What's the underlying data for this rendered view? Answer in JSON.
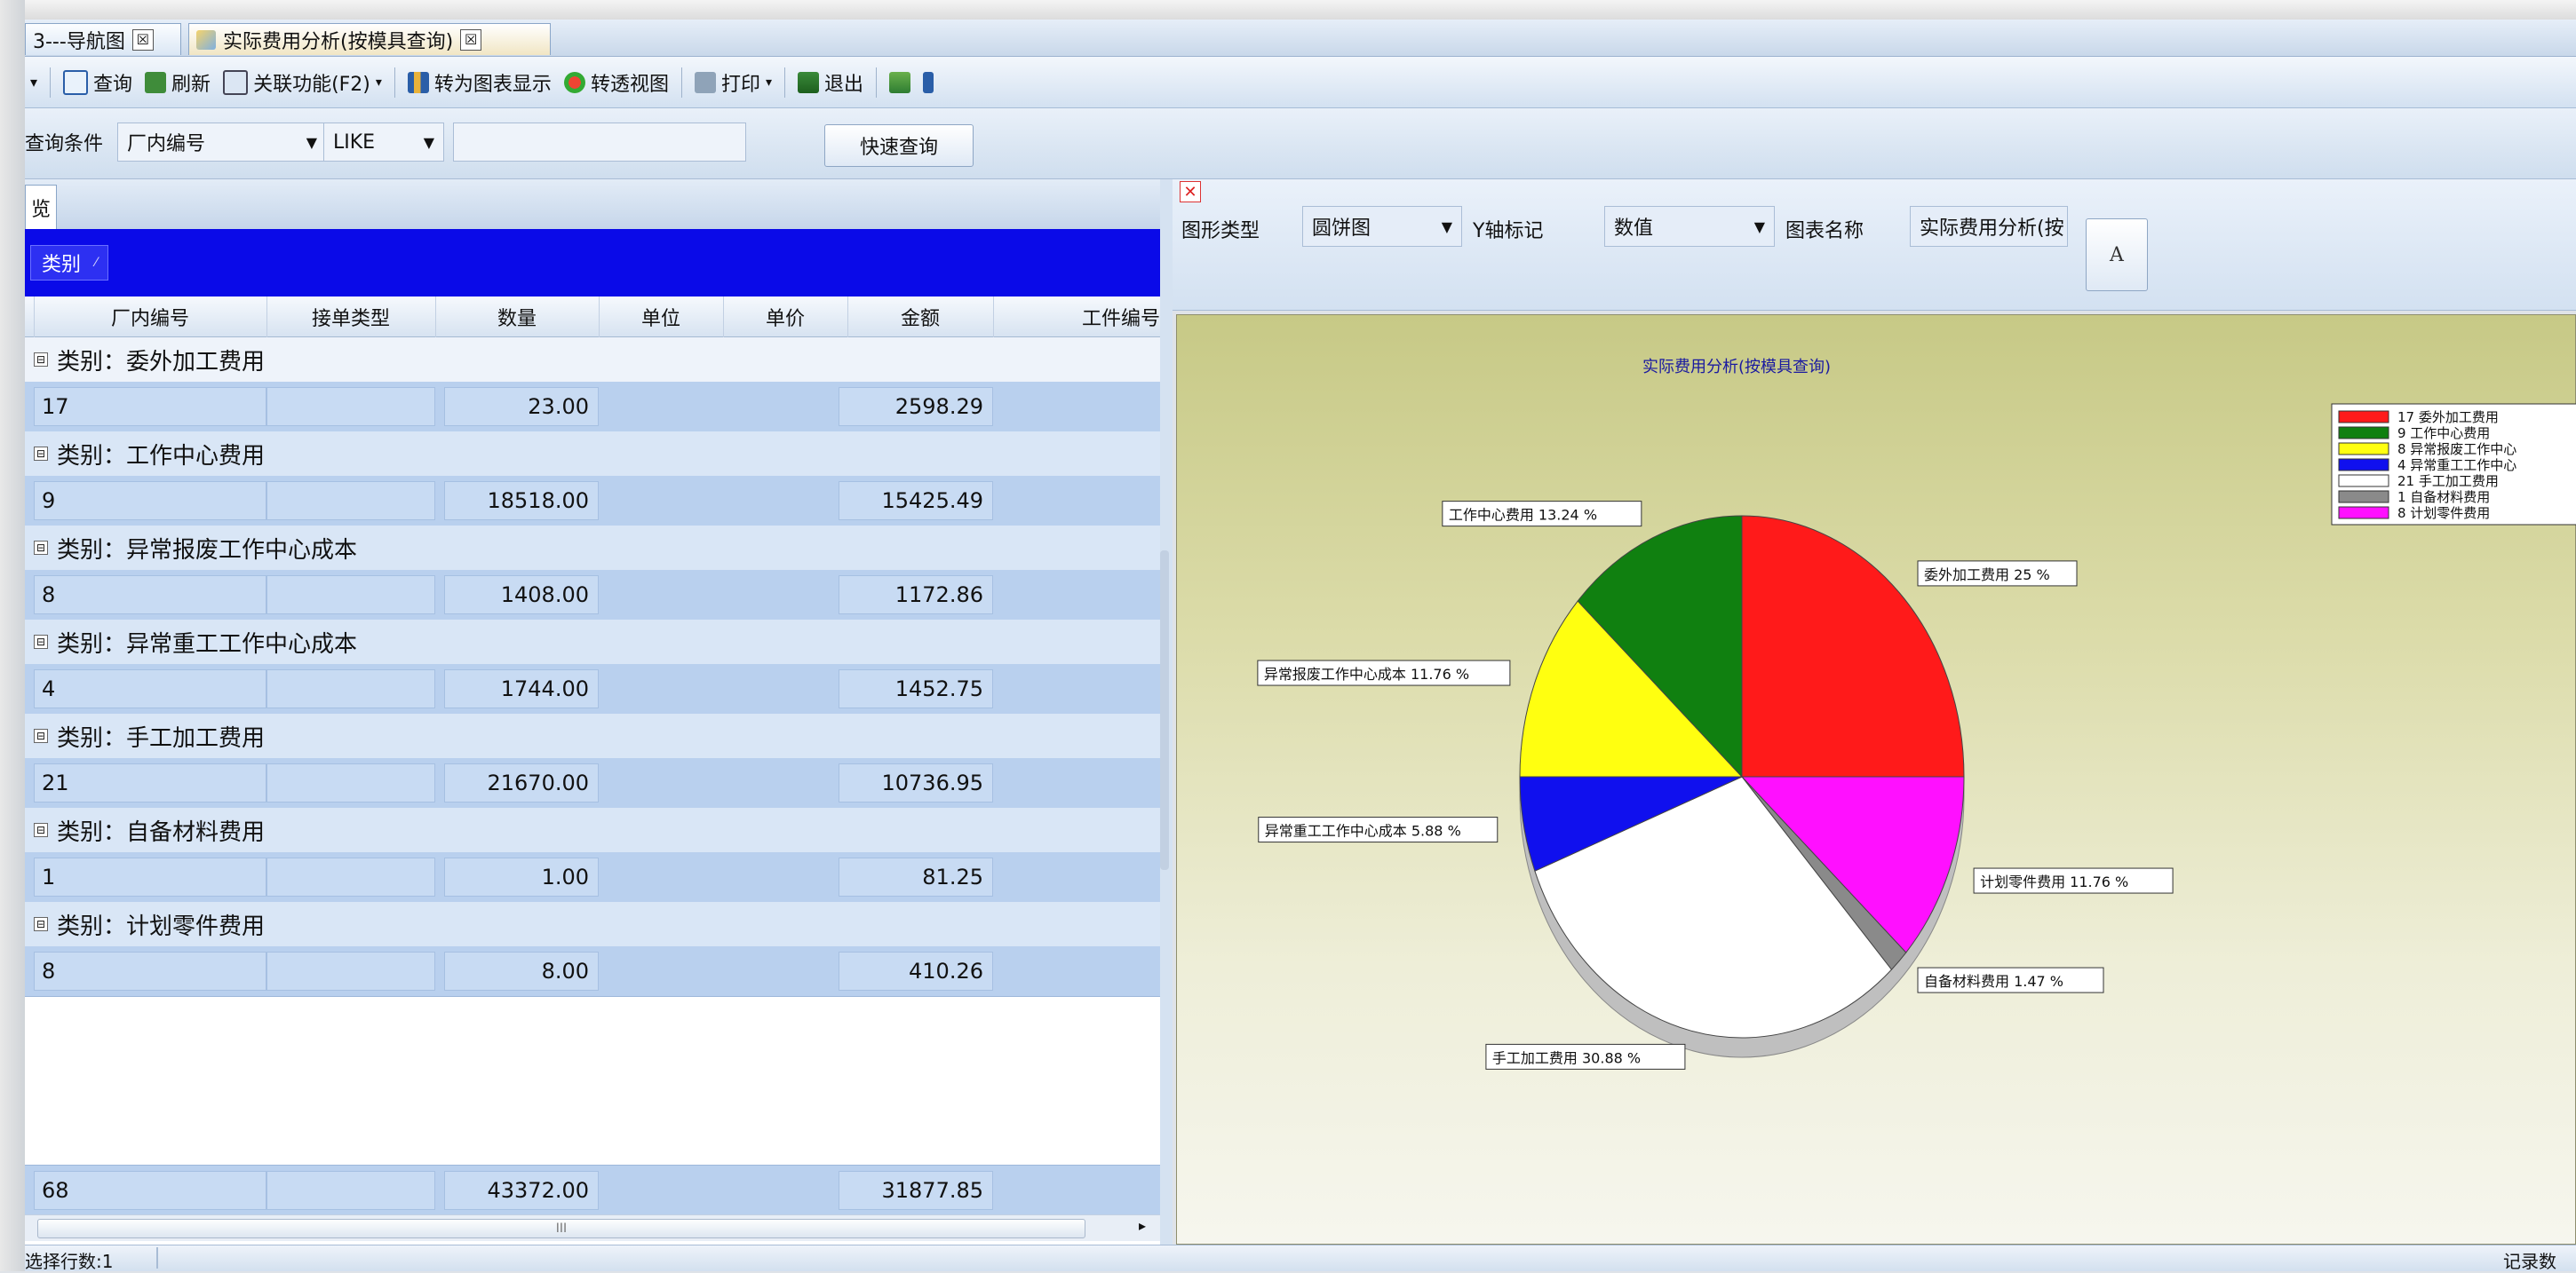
{
  "tabs": [
    {
      "label": "3---导航图",
      "close": "☒"
    },
    {
      "label": "实际费用分析(按模具查询)",
      "close": "☒"
    }
  ],
  "toolbar": {
    "query": "查询",
    "refresh": "刷新",
    "related": "关联功能(F2)",
    "to_chart": "转为图表显示",
    "pivot": "转透视图",
    "print": "打印",
    "exit": "退出"
  },
  "querybar": {
    "label": "查询条件",
    "field": "厂内编号",
    "operator": "LIKE",
    "value": "",
    "quick_query": "快速查询"
  },
  "left_panel": {
    "tab_label": "览",
    "group_chip": "类别",
    "columns": [
      "厂内编号",
      "接单类型",
      "数量",
      "单位",
      "单价",
      "金额",
      "工件编号"
    ],
    "groups": [
      {
        "title": "类别：委外加工费用",
        "count": "17",
        "qty": "23.00",
        "amount": "2598.29"
      },
      {
        "title": "类别：工作中心费用",
        "count": "9",
        "qty": "18518.00",
        "amount": "15425.49"
      },
      {
        "title": "类别：异常报废工作中心成本",
        "count": "8",
        "qty": "1408.00",
        "amount": "1172.86"
      },
      {
        "title": "类别：异常重工工作中心成本",
        "count": "4",
        "qty": "1744.00",
        "amount": "1452.75"
      },
      {
        "title": "类别：手工加工费用",
        "count": "21",
        "qty": "21670.00",
        "amount": "10736.95"
      },
      {
        "title": "类别：自备材料费用",
        "count": "1",
        "qty": "1.00",
        "amount": "81.25"
      },
      {
        "title": "类别：计划零件费用",
        "count": "8",
        "qty": "8.00",
        "amount": "410.26"
      }
    ],
    "totals": {
      "count": "68",
      "qty": "43372.00",
      "amount": "31877.85"
    },
    "scroll_mark": "III"
  },
  "chart_panel": {
    "type_label": "图形类型",
    "type_value": "圆饼图",
    "yaxis_label": "Y轴标记",
    "yaxis_value": "数值",
    "name_label": "图表名称",
    "name_value": "实际费用分析(按"
  },
  "chart_data": {
    "type": "pie",
    "title": "实际费用分析(按模具查询)",
    "slices": [
      {
        "label": "委外加工费用",
        "value": 25,
        "pct_label": "委外加工费用 25 %",
        "legend": "17 委外加工费用",
        "color": "#ff1a1a"
      },
      {
        "label": "计划零件费用",
        "value": 11.76,
        "pct_label": "计划零件费用 11.76 %",
        "legend": "8 计划零件费用",
        "color": "#ff10ff"
      },
      {
        "label": "自备材料费用",
        "value": 1.47,
        "pct_label": "自备材料费用 1.47 %",
        "legend": "1 自备材料费用",
        "color": "#8a8a8a"
      },
      {
        "label": "手工加工费用",
        "value": 30.88,
        "pct_label": "手工加工费用 30.88 %",
        "legend": "21 手工加工费用",
        "color": "#ffffff"
      },
      {
        "label": "异常重工工作中心成本",
        "value": 5.88,
        "pct_label": "异常重工工作中心成本 5.88 %",
        "legend": "4 异常重工工作中心",
        "color": "#1010ee"
      },
      {
        "label": "异常报废工作中心成本",
        "value": 11.76,
        "pct_label": "异常报废工作中心成本 11.76 %",
        "legend": "8 异常报废工作中心",
        "color": "#ffff10"
      },
      {
        "label": "工作中心费用",
        "value": 13.24,
        "pct_label": "工作中心费用 13.24 %",
        "legend": "9 工作中心费用",
        "color": "#108010"
      }
    ],
    "legend_position": "top-right"
  },
  "status": {
    "left": "选择行数:1",
    "right": "记录数"
  }
}
